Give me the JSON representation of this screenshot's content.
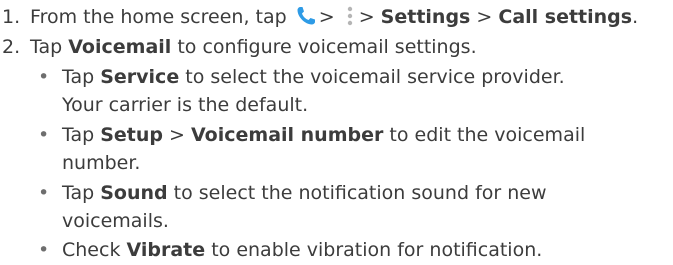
{
  "steps": [
    {
      "num": "1.",
      "pre": "From the home screen, tap",
      "sep1": ">",
      "sep2": ">",
      "settings": "Settings",
      "sep3": ">",
      "call_settings": "Call settings",
      "end": "."
    },
    {
      "num": "2.",
      "pre": "Tap",
      "voicemail": "Voicemail",
      "post": "to configure voicemail settings."
    }
  ],
  "bullets": [
    {
      "pre": "Tap",
      "bold": "Service",
      "post": "to select the voicemail service provider.",
      "cont": "Your carrier is the default."
    },
    {
      "pre": "Tap",
      "bold": "Setup",
      "sep": ">",
      "bold2": "Voicemail number",
      "post": "to edit the voicemail",
      "cont": "number."
    },
    {
      "pre": "Tap",
      "bold": "Sound",
      "post": "to select the notification sound for new",
      "cont": "voicemails."
    },
    {
      "pre": "Check",
      "bold": "Vibrate",
      "post": "to enable vibration for notification."
    }
  ],
  "icons": {
    "phone": "phone-icon",
    "more": "more-options-icon",
    "phone_color": "#2e9be6",
    "more_color": "#b5b5b5"
  }
}
